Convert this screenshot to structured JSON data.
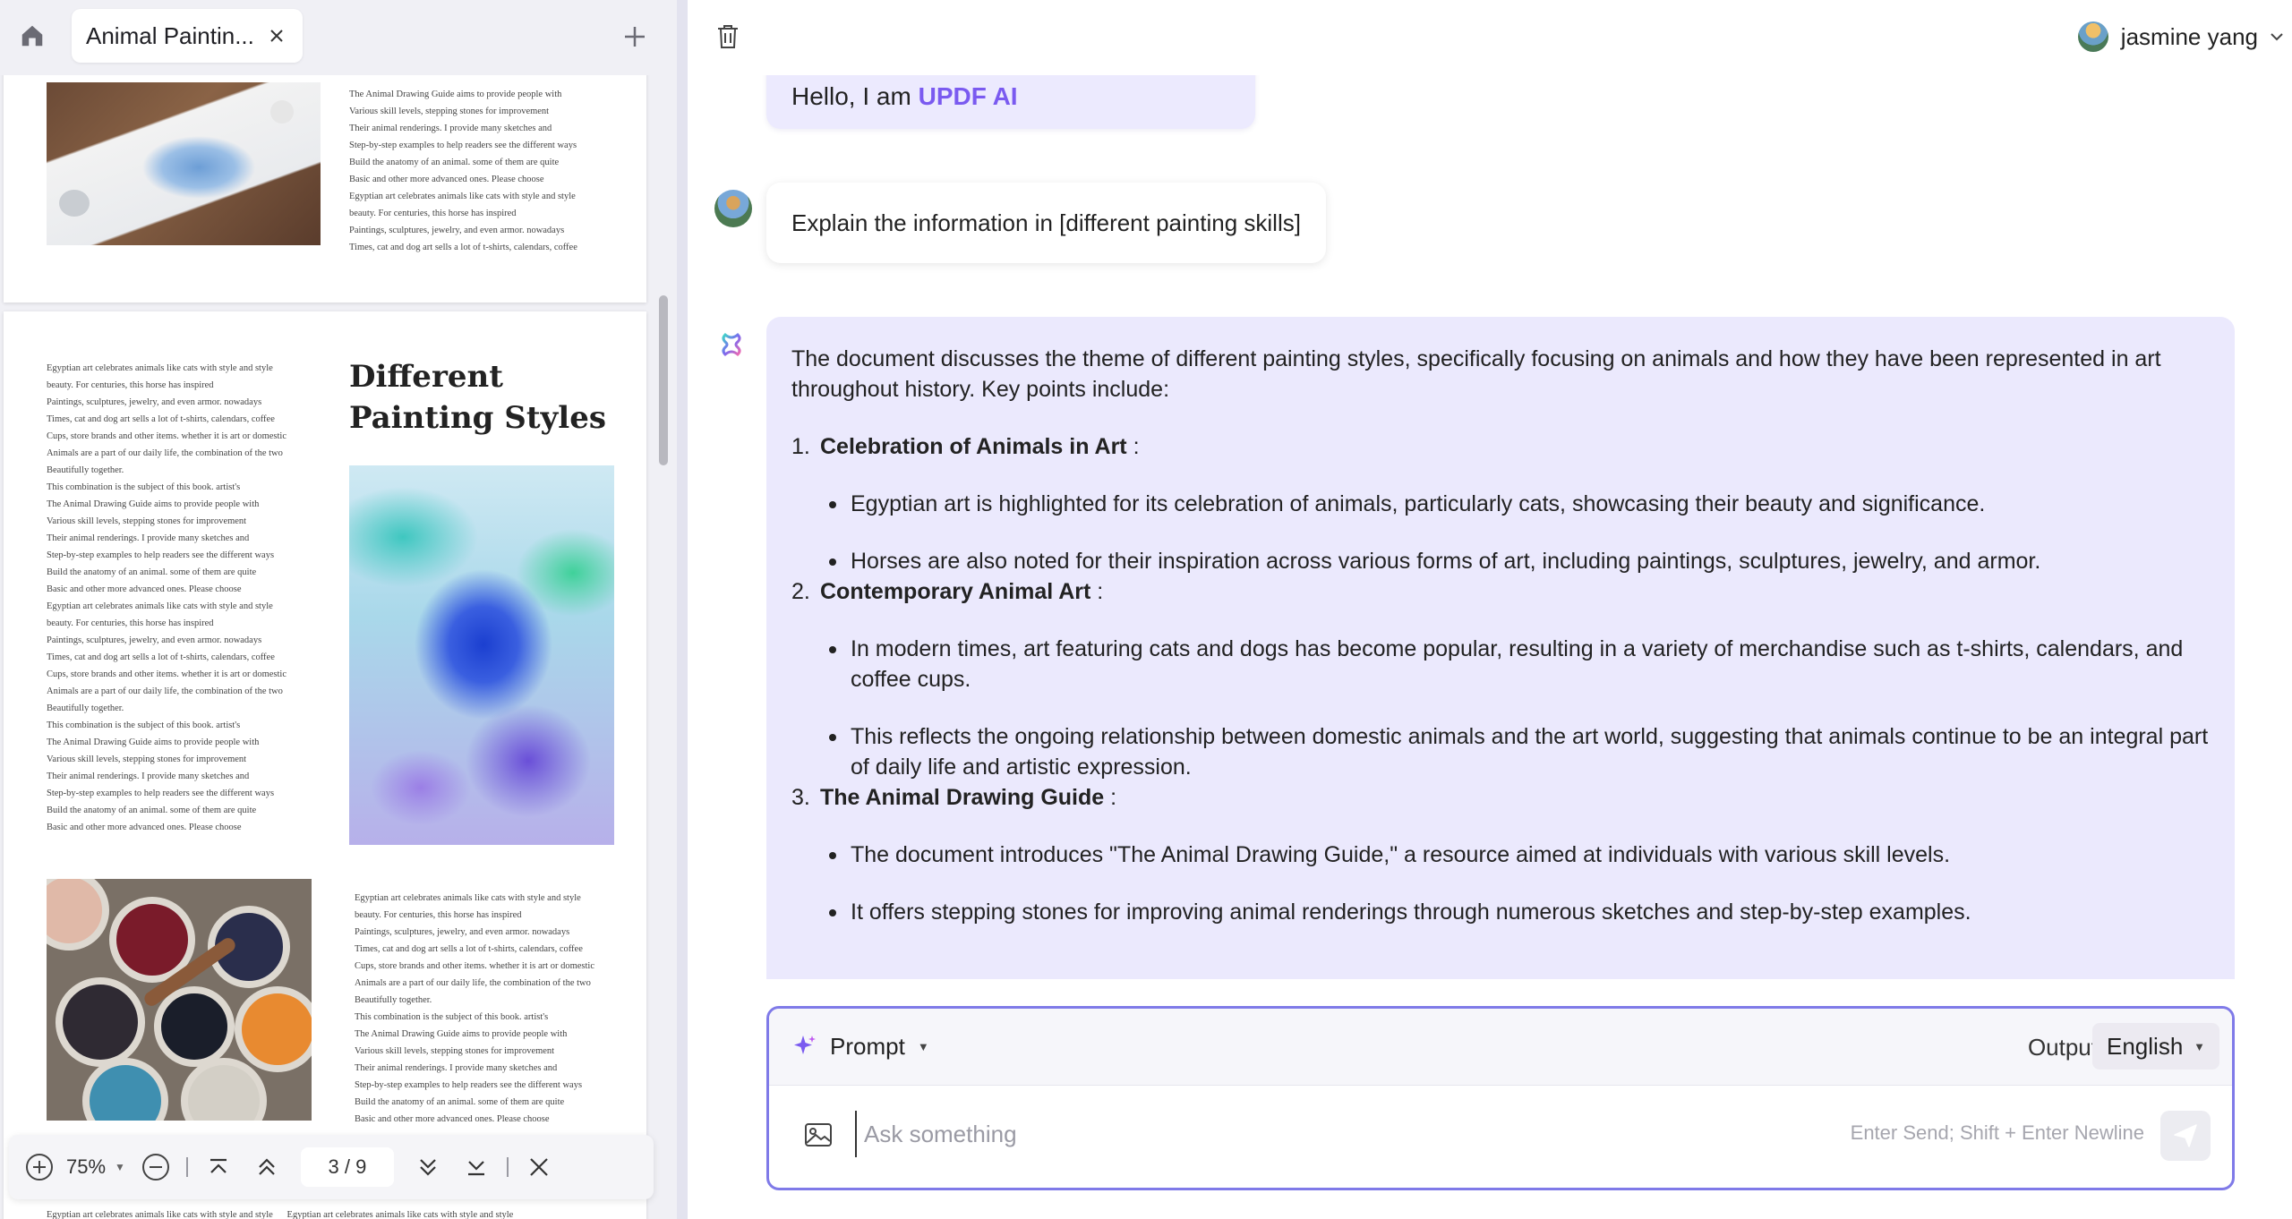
{
  "left": {
    "tab": {
      "title": "Animal Paintin...",
      "icons": {
        "home": "home-icon",
        "close": "close-icon",
        "add": "plus-icon"
      }
    },
    "page1": {
      "text": "The Animal Drawing Guide aims to provide people with\nVarious skill levels, stepping stones for improvement\nTheir animal renderings. I provide many sketches and\nStep-by-step examples to help readers see the different ways\nBuild the anatomy of an animal. some of them are quite\nBasic and other more advanced ones. Please choose\nEgyptian art celebrates animals like cats with style and style\nbeauty. For centuries, this horse has inspired\nPaintings, sculptures, jewelry, and even armor. nowadays\nTimes, cat and dog art sells a lot of t-shirts, calendars, coffee"
    },
    "page2": {
      "title": "Different Painting Styles",
      "left_text": "Egyptian art celebrates animals like cats with style and style\nbeauty. For centuries, this horse has inspired\nPaintings, sculptures, jewelry, and even armor. nowadays\nTimes, cat and dog art sells a lot of t-shirts, calendars, coffee\nCups, store brands and other items. whether it is art or domestic\nAnimals are a part of our daily life, the combination of the two\nBeautifully together.\nThis combination is the subject of this book. artist's\nThe Animal Drawing Guide aims to provide people with\nVarious skill levels, stepping stones for improvement\nTheir animal renderings. I provide many sketches and\nStep-by-step examples to help readers see the different ways\nBuild the anatomy of an animal. some of them are quite\nBasic and other more advanced ones. Please choose\nEgyptian art celebrates animals like cats with style and style\nbeauty. For centuries, this horse has inspired\nPaintings, sculptures, jewelry, and even armor. nowadays\nTimes, cat and dog art sells a lot of t-shirts, calendars, coffee\nCups, store brands and other items. whether it is art or domestic\nAnimals are a part of our daily life, the combination of the two\nBeautifully together.\nThis combination is the subject of this book. artist's\nThe Animal Drawing Guide aims to provide people with\nVarious skill levels, stepping stones for improvement\nTheir animal renderings. I provide many sketches and\nStep-by-step examples to help readers see the different ways\nBuild the anatomy of an animal. some of them are quite\nBasic and other more advanced ones. Please choose",
      "right_text": "Egyptian art celebrates animals like cats with style and style\nbeauty. For centuries, this horse has inspired\nPaintings, sculptures, jewelry, and even armor. nowadays\nTimes, cat and dog art sells a lot of t-shirts, calendars, coffee\nCups, store brands and other items. whether it is art or domestic\nAnimals are a part of our daily life, the combination of the two\nBeautifully together.\nThis combination is the subject of this book. artist's\nThe Animal Drawing Guide aims to provide people with\nVarious skill levels, stepping stones for improvement\nTheir animal renderings. I provide many sketches and\nStep-by-step examples to help readers see the different ways\nBuild the anatomy of an animal. some of them are quite\nBasic and other more advanced ones. Please choose",
      "footer_text": "Egyptian art celebrates animals like cats with style and style      Egyptian art celebrates animals like cats with style and style"
    },
    "toolbar": {
      "zoom": "75%",
      "page_indicator": "3 / 9",
      "icons": {
        "zoom_in": "zoom-in-icon",
        "zoom_out": "zoom-out-icon",
        "first": "first-page-icon",
        "prev": "prev-page-icon",
        "next": "next-page-icon",
        "last": "last-page-icon",
        "close": "close-icon"
      }
    }
  },
  "right": {
    "header": {
      "user_name": "jasmine yang",
      "icons": {
        "trash": "trash-icon",
        "caret": "chevron-down-icon"
      }
    },
    "hello": {
      "prefix": "Hello, I am ",
      "brand": "UPDF AI"
    },
    "user_message": "Explain the information in [different painting skills]",
    "ai": {
      "intro": "The document discusses the theme of different painting styles, specifically focusing on animals and how they have been represented in art throughout history. Key points include:",
      "sections": [
        {
          "num": "1.",
          "title": "Celebration of Animals in Art",
          "suffix": " :",
          "bullets": [
            "Egyptian art is highlighted for its celebration of animals, particularly cats, showcasing their beauty and significance.",
            "Horses are also noted for their inspiration across various forms of art, including paintings, sculptures, jewelry, and armor."
          ]
        },
        {
          "num": "2.",
          "title": "Contemporary Animal Art",
          "suffix": " :",
          "bullets": [
            "In modern times, art featuring cats and dogs has become popular, resulting in a variety of merchandise such as t-shirts, calendars, and coffee cups.",
            "This reflects the ongoing relationship between domestic animals and the art world, suggesting that animals continue to be an integral part of daily life and artistic expression."
          ]
        },
        {
          "num": "3.",
          "title": "The Animal Drawing Guide",
          "suffix": " :",
          "bullets": [
            "The document introduces \"The Animal Drawing Guide,\" a resource aimed at individuals with various skill levels.",
            "It offers stepping stones for improving animal renderings through numerous sketches and step-by-step examples."
          ]
        }
      ]
    },
    "composer": {
      "prompt_label": "Prompt",
      "output_label": "Output",
      "language": "English",
      "placeholder": "Ask something",
      "hint": "Enter Send; Shift + Enter Newline",
      "icons": {
        "sparkle": "sparkle-icon",
        "image": "image-icon",
        "send": "send-icon"
      }
    },
    "colors": {
      "accent": "#7f7ae8",
      "brand": "#7a5af0",
      "ai_bubble": "#ebe9fd"
    }
  }
}
